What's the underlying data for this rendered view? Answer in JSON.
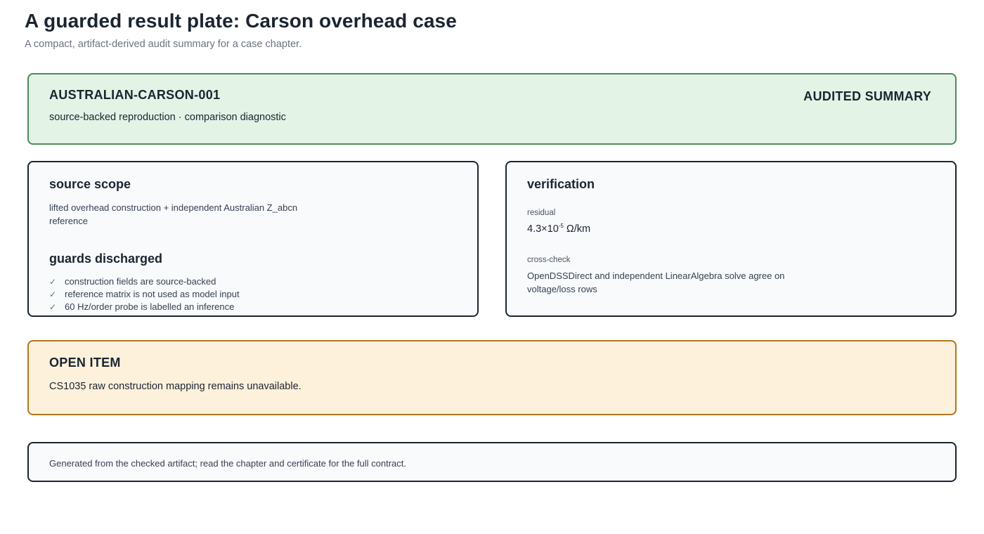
{
  "page": {
    "title": "A guarded result plate: Carson overhead case",
    "subtitle": "A compact, artifact-derived audit summary for a case chapter."
  },
  "header": {
    "case_id": "AUSTRALIAN-CARSON-001",
    "description": "source-backed reproduction · comparison diagnostic",
    "badge": "AUDITED SUMMARY"
  },
  "source_scope": {
    "heading": "source scope",
    "text": "lifted overhead construction + independent Australian Z_abcn reference"
  },
  "guards": {
    "heading": "guards discharged",
    "check_glyph": "✓",
    "items": [
      "construction fields are source-backed",
      "reference matrix is not used as model input",
      "60 Hz/order probe is labelled an inference"
    ]
  },
  "verification": {
    "heading": "verification",
    "residual_label": "residual",
    "residual_mantissa": "4.3×10",
    "residual_exponent": "-5",
    "residual_unit": " Ω/km",
    "crosscheck_label": "cross-check",
    "crosscheck_text": "OpenDSSDirect and independent LinearAlgebra solve agree on voltage/loss rows"
  },
  "open_item": {
    "heading": "OPEN ITEM",
    "text": "CS1035 raw construction mapping remains unavailable."
  },
  "footer": {
    "text": "Generated from the checked artifact; read the chapter and certificate for the full contract."
  },
  "colors": {
    "header_bg": "#e3f3e6",
    "header_border": "#4d8a5c",
    "open_bg": "#fdf1dc",
    "open_border": "#b0771f",
    "check": "#3f8a52"
  }
}
